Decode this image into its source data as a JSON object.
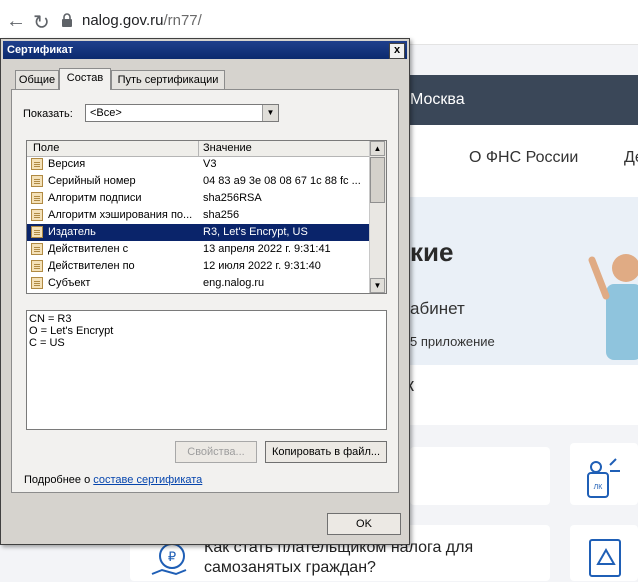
{
  "browser": {
    "back_icon": "arrow-left-icon",
    "reload_icon": "reload-icon",
    "url_host": "nalog.gov.ru",
    "url_path": "/rn77/"
  },
  "site": {
    "region": "Москва",
    "nav": [
      "О ФНС России",
      "Де"
    ],
    "hero_title": "кие",
    "hero_subtitle": "абинет",
    "hero_note": "5 приложение",
    "strip_text": "к",
    "card_text_line1": "Как стать плательщиком налога для",
    "card_text_line2": "самозанятых граждан?",
    "card_badge": "ЛК"
  },
  "dialog": {
    "title": "Сертификат",
    "close_label": "x",
    "tabs": [
      {
        "label": "Общие",
        "active": false
      },
      {
        "label": "Состав",
        "active": true
      },
      {
        "label": "Путь сертификации",
        "active": false
      }
    ],
    "show_label": "Показать:",
    "show_value": "<Все>",
    "columns": [
      "Поле",
      "Значение"
    ],
    "rows": [
      {
        "field": "Версия",
        "value": "V3",
        "selected": false
      },
      {
        "field": "Серийный номер",
        "value": "04 83 a9 3e 08 08 67 1c 88 fc ...",
        "selected": false
      },
      {
        "field": "Алгоритм подписи",
        "value": "sha256RSA",
        "selected": false
      },
      {
        "field": "Алгоритм хэширования по...",
        "value": "sha256",
        "selected": false
      },
      {
        "field": "Издатель",
        "value": "R3, Let's Encrypt, US",
        "selected": true
      },
      {
        "field": "Действителен с",
        "value": "13 апреля 2022 г. 9:31:41",
        "selected": false
      },
      {
        "field": "Действителен по",
        "value": "12 июля 2022 г. 9:31:40",
        "selected": false
      },
      {
        "field": "Субъект",
        "value": "eng.nalog.ru",
        "selected": false
      }
    ],
    "detail_lines": [
      "CN = R3",
      "O = Let's Encrypt",
      "C = US"
    ],
    "properties_button": "Свойства...",
    "copy_button": "Копировать в файл...",
    "more_prefix": "Подробнее о ",
    "more_link": "составе сертификата",
    "ok_button": "OK"
  }
}
